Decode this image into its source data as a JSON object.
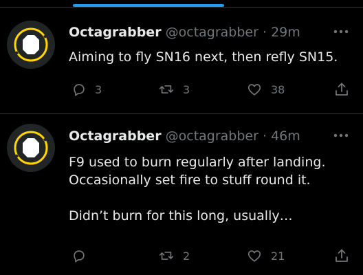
{
  "tweets": [
    {
      "display_name": "Octagrabber",
      "handle": "@octagrabber",
      "separator": "·",
      "time": "29m",
      "text_lines": [
        "Aiming to fly SN16 next, then refly SN15."
      ],
      "reply_count": "3",
      "retweet_count": "3",
      "like_count": "38"
    },
    {
      "display_name": "Octagrabber",
      "handle": "@octagrabber",
      "separator": "·",
      "time": "46m",
      "text_lines": [
        "F9 used to burn regularly after landing.",
        "Occasionally set fire to stuff round it.",
        "",
        "Didn’t burn for this long, usually…"
      ],
      "reply_count": "",
      "retweet_count": "2",
      "like_count": "21"
    }
  ],
  "icons": {
    "avatar": "octagon-avatar-icon",
    "more": "more-icon",
    "reply": "reply-icon",
    "retweet": "retweet-icon",
    "like": "heart-icon",
    "share": "share-icon"
  },
  "colors": {
    "background": "#000000",
    "accent": "#1d9bf0",
    "avatar_ring": "#ffd400",
    "muted": "#71767b",
    "text": "#e7e9ea",
    "divider": "#2f3336"
  }
}
